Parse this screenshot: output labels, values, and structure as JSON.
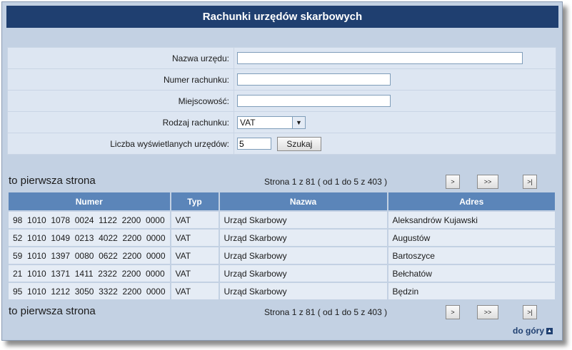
{
  "title": "Rachunki urzędów skarbowych",
  "form": {
    "office_name_label": "Nazwa urzędu:",
    "office_name_value": "",
    "account_number_label": "Numer rachunku:",
    "account_number_value": "",
    "city_label": "Miejscowość:",
    "city_value": "",
    "account_type_label": "Rodzaj rachunku:",
    "account_type_value": "VAT",
    "count_label": "Liczba wyświetlanych urzędów:",
    "count_value": "5",
    "search_button": "Szukaj"
  },
  "pagination": {
    "first_page_text": "to pierwsza strona",
    "page_info": "Strona 1 z 81 ( od 1 do 5 z 403 )",
    "next": ">",
    "next_many": ">>",
    "last": ">|"
  },
  "table": {
    "headers": [
      "Numer",
      "Typ",
      "Nazwa",
      "Adres"
    ],
    "rows": [
      {
        "numer": "98  1010  1078  0024  1122  2200  0000",
        "typ": "VAT",
        "nazwa": "Urząd Skarbowy",
        "adres": "Aleksandrów Kujawski"
      },
      {
        "numer": "52  1010  1049  0213  4022  2200  0000",
        "typ": "VAT",
        "nazwa": "Urząd Skarbowy",
        "adres": "Augustów"
      },
      {
        "numer": "59  1010  1397  0080  0622  2200  0000",
        "typ": "VAT",
        "nazwa": "Urząd Skarbowy",
        "adres": "Bartoszyce"
      },
      {
        "numer": "21  1010  1371  1411  2322  2200  0000",
        "typ": "VAT",
        "nazwa": "Urząd Skarbowy",
        "adres": "Bełchatów"
      },
      {
        "numer": "95  1010  1212  3050  3322  2200  0000",
        "typ": "VAT",
        "nazwa": "Urząd Skarbowy",
        "adres": "Będzin"
      }
    ]
  },
  "back_to_top": "do góry"
}
